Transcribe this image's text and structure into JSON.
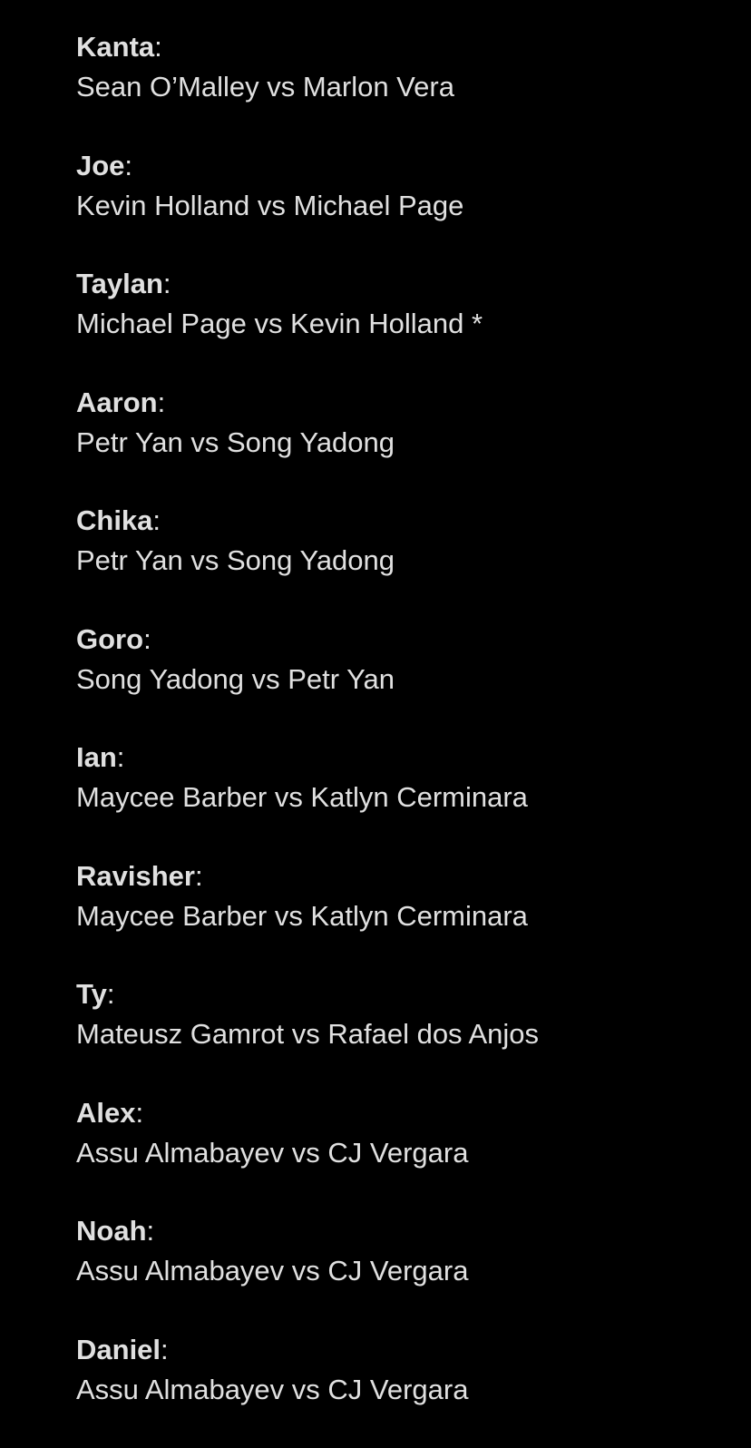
{
  "picks": [
    {
      "name": "Kanta",
      "matchup": "Sean O’Malley vs Marlon Vera"
    },
    {
      "name": "Joe",
      "matchup": "Kevin Holland vs Michael Page"
    },
    {
      "name": "Taylan",
      "matchup": "Michael Page vs Kevin Holland *"
    },
    {
      "name": "Aaron",
      "matchup": "Petr Yan vs Song Yadong"
    },
    {
      "name": "Chika",
      "matchup": "Petr Yan vs Song Yadong"
    },
    {
      "name": "Goro",
      "matchup": "Song Yadong vs Petr Yan"
    },
    {
      "name": "Ian",
      "matchup": "Maycee Barber vs Katlyn Cerminara"
    },
    {
      "name": "Ravisher",
      "matchup": "Maycee Barber vs Katlyn Cerminara"
    },
    {
      "name": "Ty",
      "matchup": "Mateusz Gamrot vs Rafael dos Anjos"
    },
    {
      "name": "Alex",
      "matchup": "Assu Almabayev vs CJ Vergara"
    },
    {
      "name": "Noah",
      "matchup": "Assu Almabayev vs CJ Vergara"
    },
    {
      "name": "Daniel",
      "matchup": "Assu Almabayev vs CJ Vergara"
    }
  ],
  "separator": ":",
  "colors": {
    "background": "#000000",
    "text": "#e0e0e0"
  }
}
